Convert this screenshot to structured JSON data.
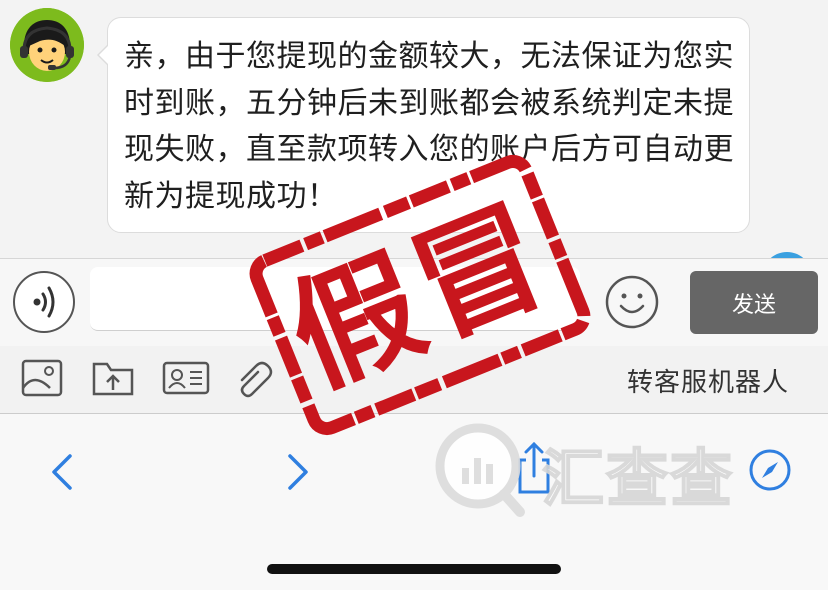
{
  "chat": {
    "message": "亲，由于您提现的金额较大，无法保证为您实时到账，五分钟后未到账都会被系统判定未提现失败，直至款项转入您的账户后方可自动更新为提现成功！",
    "avatar_icon": "customer-service-agent-icon",
    "avatar_color": "#7dbb1d"
  },
  "input_bar": {
    "voice_icon": "voice-input-icon",
    "text_value": "",
    "emoji_icon": "smiley-icon",
    "send_label": "发送",
    "send_color": "#666666"
  },
  "toolbar": {
    "tools": [
      "image-icon",
      "folder-upload-icon",
      "contact-card-icon",
      "attach-icon"
    ],
    "transfer_label": "转客服机器人"
  },
  "browser": {
    "back_icon": "chevron-left-icon",
    "forward_icon": "chevron-right-icon",
    "share_icon": "share-icon",
    "compass_icon": "compass-icon",
    "accent_color": "#2f7fe0"
  },
  "stamp": {
    "text": "假冒",
    "color": "#c8161d"
  },
  "watermark": {
    "text": "汇查查"
  }
}
